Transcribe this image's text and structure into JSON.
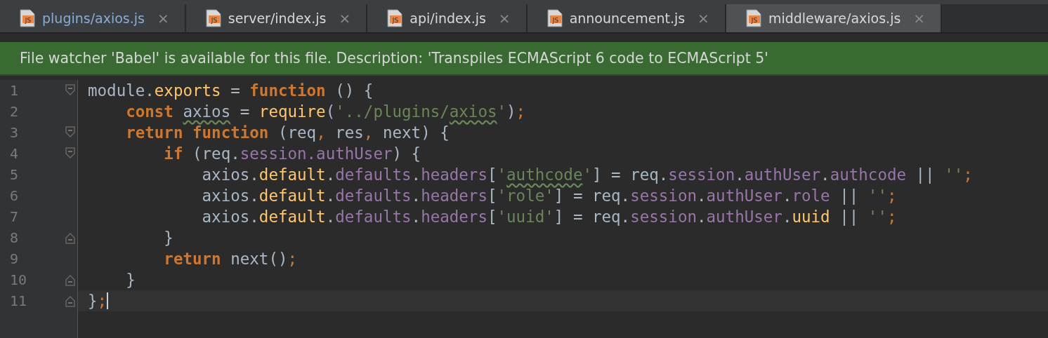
{
  "tabs": [
    {
      "label": "plugins/axios.js",
      "icon": "JS",
      "close": "×",
      "selected": false,
      "modified": true
    },
    {
      "label": "server/index.js",
      "icon": "JS",
      "close": "×",
      "selected": false,
      "modified": false
    },
    {
      "label": "api/index.js",
      "icon": "JS",
      "close": "×",
      "selected": false,
      "modified": false
    },
    {
      "label": "announcement.js",
      "icon": "JS",
      "close": "×",
      "selected": false,
      "modified": false
    },
    {
      "label": "middleware/axios.js",
      "icon": "JS",
      "close": "×",
      "selected": true,
      "modified": false
    }
  ],
  "banner": {
    "text": "File watcher 'Babel' is available for this file. Description: 'Transpiles ECMAScript 6 code to ECMAScript 5'"
  },
  "editor": {
    "lines": [
      {
        "number": "1",
        "fold_start": true,
        "fold_end": false,
        "current": false,
        "tokens": [
          {
            "kind": "plain",
            "text": "module."
          },
          {
            "kind": "method",
            "text": "exports"
          },
          {
            "kind": "plain",
            "text": " = "
          },
          {
            "kind": "keyword",
            "text": "function"
          },
          {
            "kind": "plain",
            "text": " () {"
          }
        ]
      },
      {
        "number": "2",
        "fold_start": false,
        "fold_end": false,
        "current": false,
        "tokens": [
          {
            "kind": "keyword",
            "text": "    const "
          },
          {
            "kind": "plain",
            "text": "axios",
            "typo": true
          },
          {
            "kind": "plain",
            "text": " = "
          },
          {
            "kind": "method",
            "text": "require"
          },
          {
            "kind": "plain",
            "text": "("
          },
          {
            "kind": "string",
            "text": "'../plugins/"
          },
          {
            "kind": "string",
            "text": "axios",
            "typo": true
          },
          {
            "kind": "string",
            "text": "'"
          },
          {
            "kind": "plain",
            "text": ")"
          },
          {
            "kind": "punct",
            "text": ";"
          }
        ]
      },
      {
        "number": "3",
        "fold_start": true,
        "fold_end": false,
        "current": false,
        "tokens": [
          {
            "kind": "keyword",
            "text": "    return function"
          },
          {
            "kind": "plain",
            "text": " (req"
          },
          {
            "kind": "punct",
            "text": ","
          },
          {
            "kind": "plain",
            "text": " res"
          },
          {
            "kind": "punct",
            "text": ","
          },
          {
            "kind": "plain",
            "text": " next) {"
          }
        ]
      },
      {
        "number": "4",
        "fold_start": true,
        "fold_end": false,
        "current": false,
        "tokens": [
          {
            "kind": "keyword",
            "text": "        if"
          },
          {
            "kind": "plain",
            "text": " (req."
          },
          {
            "kind": "property",
            "text": "session.authUser"
          },
          {
            "kind": "plain",
            "text": ") {"
          }
        ]
      },
      {
        "number": "5",
        "fold_start": false,
        "fold_end": false,
        "current": false,
        "tokens": [
          {
            "kind": "plain",
            "text": "            axios."
          },
          {
            "kind": "method",
            "text": "default"
          },
          {
            "kind": "plain",
            "text": "."
          },
          {
            "kind": "property",
            "text": "defaults"
          },
          {
            "kind": "plain",
            "text": "."
          },
          {
            "kind": "property",
            "text": "headers"
          },
          {
            "kind": "plain",
            "text": "["
          },
          {
            "kind": "string",
            "text": "'"
          },
          {
            "kind": "string",
            "text": "authcode",
            "typo": true
          },
          {
            "kind": "string",
            "text": "'"
          },
          {
            "kind": "plain",
            "text": "] = req."
          },
          {
            "kind": "property",
            "text": "session"
          },
          {
            "kind": "plain",
            "text": "."
          },
          {
            "kind": "property",
            "text": "authUser"
          },
          {
            "kind": "plain",
            "text": "."
          },
          {
            "kind": "property",
            "text": "authcode"
          },
          {
            "kind": "plain",
            "text": " || "
          },
          {
            "kind": "string",
            "text": "''"
          },
          {
            "kind": "punct",
            "text": ";"
          }
        ]
      },
      {
        "number": "6",
        "fold_start": false,
        "fold_end": false,
        "current": false,
        "tokens": [
          {
            "kind": "plain",
            "text": "            axios."
          },
          {
            "kind": "method",
            "text": "default"
          },
          {
            "kind": "plain",
            "text": "."
          },
          {
            "kind": "property",
            "text": "defaults"
          },
          {
            "kind": "plain",
            "text": "."
          },
          {
            "kind": "property",
            "text": "headers"
          },
          {
            "kind": "plain",
            "text": "["
          },
          {
            "kind": "string",
            "text": "'role'"
          },
          {
            "kind": "plain",
            "text": "] = req."
          },
          {
            "kind": "property",
            "text": "session"
          },
          {
            "kind": "plain",
            "text": "."
          },
          {
            "kind": "property",
            "text": "authUser"
          },
          {
            "kind": "plain",
            "text": "."
          },
          {
            "kind": "property",
            "text": "role"
          },
          {
            "kind": "plain",
            "text": " || "
          },
          {
            "kind": "string",
            "text": "''"
          },
          {
            "kind": "punct",
            "text": ";"
          }
        ]
      },
      {
        "number": "7",
        "fold_start": false,
        "fold_end": false,
        "current": false,
        "tokens": [
          {
            "kind": "plain",
            "text": "            axios."
          },
          {
            "kind": "method",
            "text": "default"
          },
          {
            "kind": "plain",
            "text": "."
          },
          {
            "kind": "property",
            "text": "defaults"
          },
          {
            "kind": "plain",
            "text": "."
          },
          {
            "kind": "property",
            "text": "headers"
          },
          {
            "kind": "plain",
            "text": "["
          },
          {
            "kind": "string",
            "text": "'uuid'"
          },
          {
            "kind": "plain",
            "text": "] = req."
          },
          {
            "kind": "property",
            "text": "session"
          },
          {
            "kind": "plain",
            "text": "."
          },
          {
            "kind": "property",
            "text": "authUser"
          },
          {
            "kind": "plain",
            "text": "."
          },
          {
            "kind": "method",
            "text": "uuid"
          },
          {
            "kind": "plain",
            "text": " || "
          },
          {
            "kind": "string",
            "text": "''"
          },
          {
            "kind": "punct",
            "text": ";"
          }
        ]
      },
      {
        "number": "8",
        "fold_start": false,
        "fold_end": true,
        "current": false,
        "tokens": [
          {
            "kind": "plain",
            "text": "        }"
          }
        ]
      },
      {
        "number": "9",
        "fold_start": false,
        "fold_end": false,
        "current": false,
        "tokens": [
          {
            "kind": "keyword",
            "text": "        return "
          },
          {
            "kind": "plain",
            "text": "next()"
          },
          {
            "kind": "punct",
            "text": ";"
          }
        ]
      },
      {
        "number": "10",
        "fold_start": false,
        "fold_end": true,
        "current": false,
        "tokens": [
          {
            "kind": "plain",
            "text": "    }"
          }
        ]
      },
      {
        "number": "11",
        "fold_start": false,
        "fold_end": true,
        "current": true,
        "tokens": [
          {
            "kind": "plain",
            "text": "}"
          },
          {
            "kind": "punct",
            "text": ";"
          }
        ]
      }
    ]
  }
}
